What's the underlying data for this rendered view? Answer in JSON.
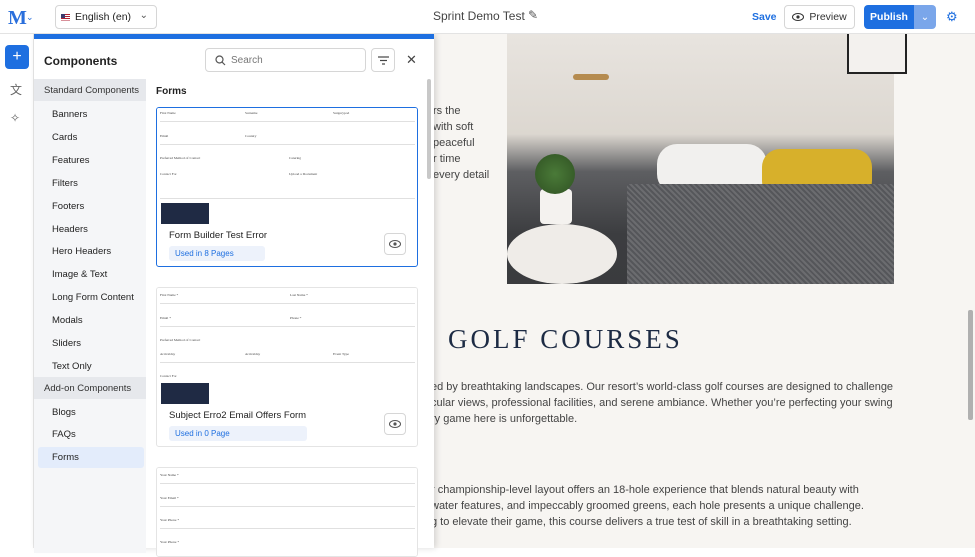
{
  "topbar": {
    "logo": "M",
    "language": "English (en)",
    "title": "Sprint Demo Test",
    "save": "Save",
    "preview": "Preview",
    "publish": "Publish"
  },
  "panel": {
    "title": "Components",
    "search_placeholder": "Search",
    "standard_header": "Standard Components",
    "standard_items": [
      "Banners",
      "Cards",
      "Features",
      "Filters",
      "Footers",
      "Headers",
      "Hero Headers",
      "Image & Text",
      "Long Form Content",
      "Modals",
      "Sliders",
      "Text Only"
    ],
    "addon_header": "Add-on Components",
    "addon_items": [
      "Blogs",
      "FAQs",
      "Forms"
    ],
    "section_title": "Forms",
    "cards": [
      {
        "name": "Form Builder Test Error",
        "usage": "Used in 8 Pages"
      },
      {
        "name": "Subject Erro2 Email Offers Form",
        "usage": "Used in 0 Page"
      }
    ]
  },
  "page": {
    "heading": "GOLF COURSES",
    "frag1": [
      "rs the",
      "with soft",
      "peaceful",
      "r time",
      "every detail"
    ],
    "para1": [
      "ed by breathtaking landscapes. Our resort’s world-class golf courses are designed to challenge",
      "cular views, professional facilities, and serene ambiance. Whether you’re perfecting your swing",
      "ry game here is unforgettable."
    ],
    "para2": [
      "r championship-level layout offers an 18-hole experience that blends natural beauty with",
      "water features, and impeccably groomed greens, each hole presents a unique challenge.",
      "g to elevate their game, this course delivers a true test of skill in a breathtaking setting."
    ]
  },
  "colors": {
    "accent": "#1e6fe0",
    "heading": "#1d2b44"
  }
}
